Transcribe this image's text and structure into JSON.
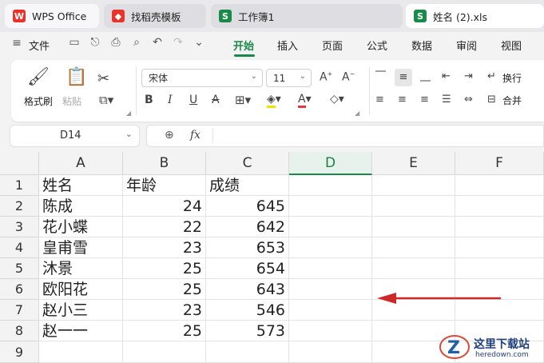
{
  "tabs": [
    {
      "label": "WPS Office",
      "icon": "wps-logo-icon",
      "color": "#e8322a"
    },
    {
      "label": "找稻壳模板",
      "icon": "docer-icon",
      "color": "#e8322a"
    },
    {
      "label": "工作簿1",
      "icon": "spreadsheet-s-icon",
      "color": "#1a8a4a"
    },
    {
      "label": "姓名 (2).xls",
      "icon": "spreadsheet-s-icon",
      "color": "#1a8a4a"
    }
  ],
  "menu": {
    "file": "文件",
    "items": [
      "开始",
      "插入",
      "页面",
      "公式",
      "数据",
      "审阅",
      "视图"
    ],
    "active": "开始"
  },
  "ribbon": {
    "format_painter": "格式刷",
    "paste": "粘贴",
    "font_name": "宋体",
    "font_size": "11",
    "wrap_text": "换行",
    "merge": "合并"
  },
  "formula_bar": {
    "name_box": "D14",
    "fx": "fx",
    "formula": ""
  },
  "sheet": {
    "columns": [
      "A",
      "B",
      "C",
      "D",
      "E",
      "F"
    ],
    "active_column": "D",
    "rows": [
      "1",
      "2",
      "3",
      "4",
      "5",
      "6",
      "7",
      "8",
      "9"
    ],
    "header_row": [
      "姓名",
      "年龄",
      "成绩"
    ],
    "data": [
      {
        "name": "陈成",
        "age": "24",
        "score": "645"
      },
      {
        "name": "花小蝶",
        "age": "22",
        "score": "642"
      },
      {
        "name": "皇甫雪",
        "age": "23",
        "score": "653"
      },
      {
        "name": "沐景",
        "age": "25",
        "score": "654"
      },
      {
        "name": "欧阳花",
        "age": "25",
        "score": "643"
      },
      {
        "name": "赵小三",
        "age": "23",
        "score": "546"
      },
      {
        "name": "赵一一",
        "age": "25",
        "score": "573"
      }
    ]
  },
  "watermark": {
    "title": "这里下载站",
    "url": "heredown.com"
  },
  "colors": {
    "accent": "#1a8a4a",
    "arrow": "#cc2a2a"
  }
}
